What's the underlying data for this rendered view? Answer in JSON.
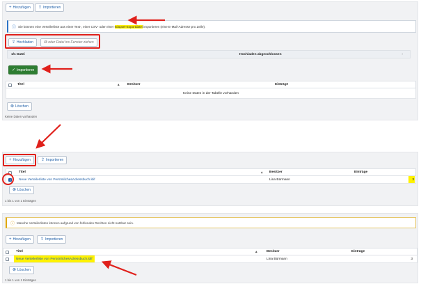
{
  "panel1": {
    "add_label": "Hinzufügen",
    "import_label": "Importieren",
    "info_before": "Sie können eine Verteilerliste aus einer Text-, einer CSV- oder einer",
    "info_highlight": "edoport-Exportdatei",
    "info_after": "importieren (eine E-Mail-Adresse pro Zeile).",
    "upload_label": "Hochladen",
    "drop_label": "oder Datei ins Fenster ziehen",
    "file_count": "1/1 Datei",
    "upload_status": "Hochladen abgeschlossen",
    "upload_progress": 1.0,
    "import_button": "Importieren",
    "columns": [
      "Titel",
      "Besitzer",
      "Einträge"
    ],
    "empty_text": "Keine Daten in der Tabelle vorhanden",
    "delete_label": "Löschen",
    "footer": "Keine Daten vorhanden"
  },
  "panel2": {
    "add_label": "Hinzufügen",
    "import_label": "Importieren",
    "columns": [
      "Titel",
      "Besitzer",
      "Einträge"
    ],
    "rows": [
      {
        "title": "Neue Verteilerliste von PersönlichesAdressbuch.ldif",
        "owner": "Lina Bürmann",
        "entries": "3",
        "checked": true
      }
    ],
    "delete_label": "Löschen",
    "footer": "1 bis 1 von 1 Einträgen"
  },
  "panel3": {
    "warning": "Manche Verteilerlisten können aufgrund von fehlenden Rechten nicht nutzbar sein.",
    "add_label": "Hinzufügen",
    "import_label": "Importieren",
    "columns": [
      "Titel",
      "Besitzer",
      "Einträge"
    ],
    "rows": [
      {
        "title": "Neue Verteilerliste von PersönlichesAdressbuch.ldif",
        "owner": "Lina Bürmann",
        "entries": "3",
        "checked": false
      }
    ],
    "delete_label": "Löschen",
    "footer": "1 bis 1 von 1 Einträgen"
  },
  "colors": {
    "accent": "#1f5fa8",
    "highlight": "#fff200",
    "annotation": "#e0201b",
    "success": "#2e7d32"
  },
  "icons": [
    "plus-icon",
    "upload-icon",
    "info-icon",
    "copy-icon",
    "check-icon",
    "circle-x-icon",
    "warning-icon",
    "chevron-right-icon"
  ]
}
